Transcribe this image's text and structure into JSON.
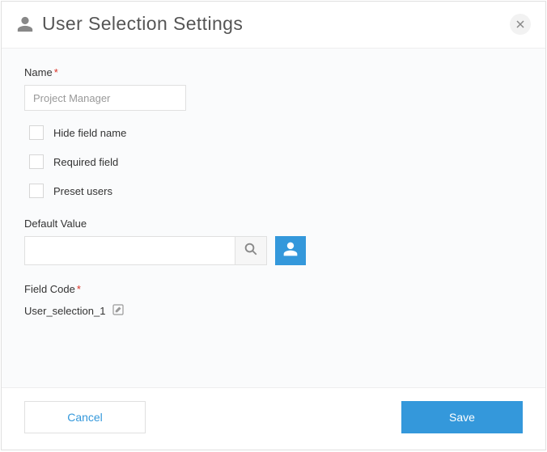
{
  "dialog": {
    "title": "User Selection Settings"
  },
  "form": {
    "name": {
      "label": "Name",
      "value": "Project Manager",
      "required": true
    },
    "checkboxes": {
      "hide_field_name": {
        "label": "Hide field name",
        "checked": false
      },
      "required_field": {
        "label": "Required field",
        "checked": false
      },
      "preset_users": {
        "label": "Preset users",
        "checked": false
      }
    },
    "default_value": {
      "label": "Default Value",
      "value": ""
    },
    "field_code": {
      "label": "Field Code",
      "required": true,
      "value": "User_selection_1"
    }
  },
  "footer": {
    "cancel": "Cancel",
    "save": "Save"
  }
}
